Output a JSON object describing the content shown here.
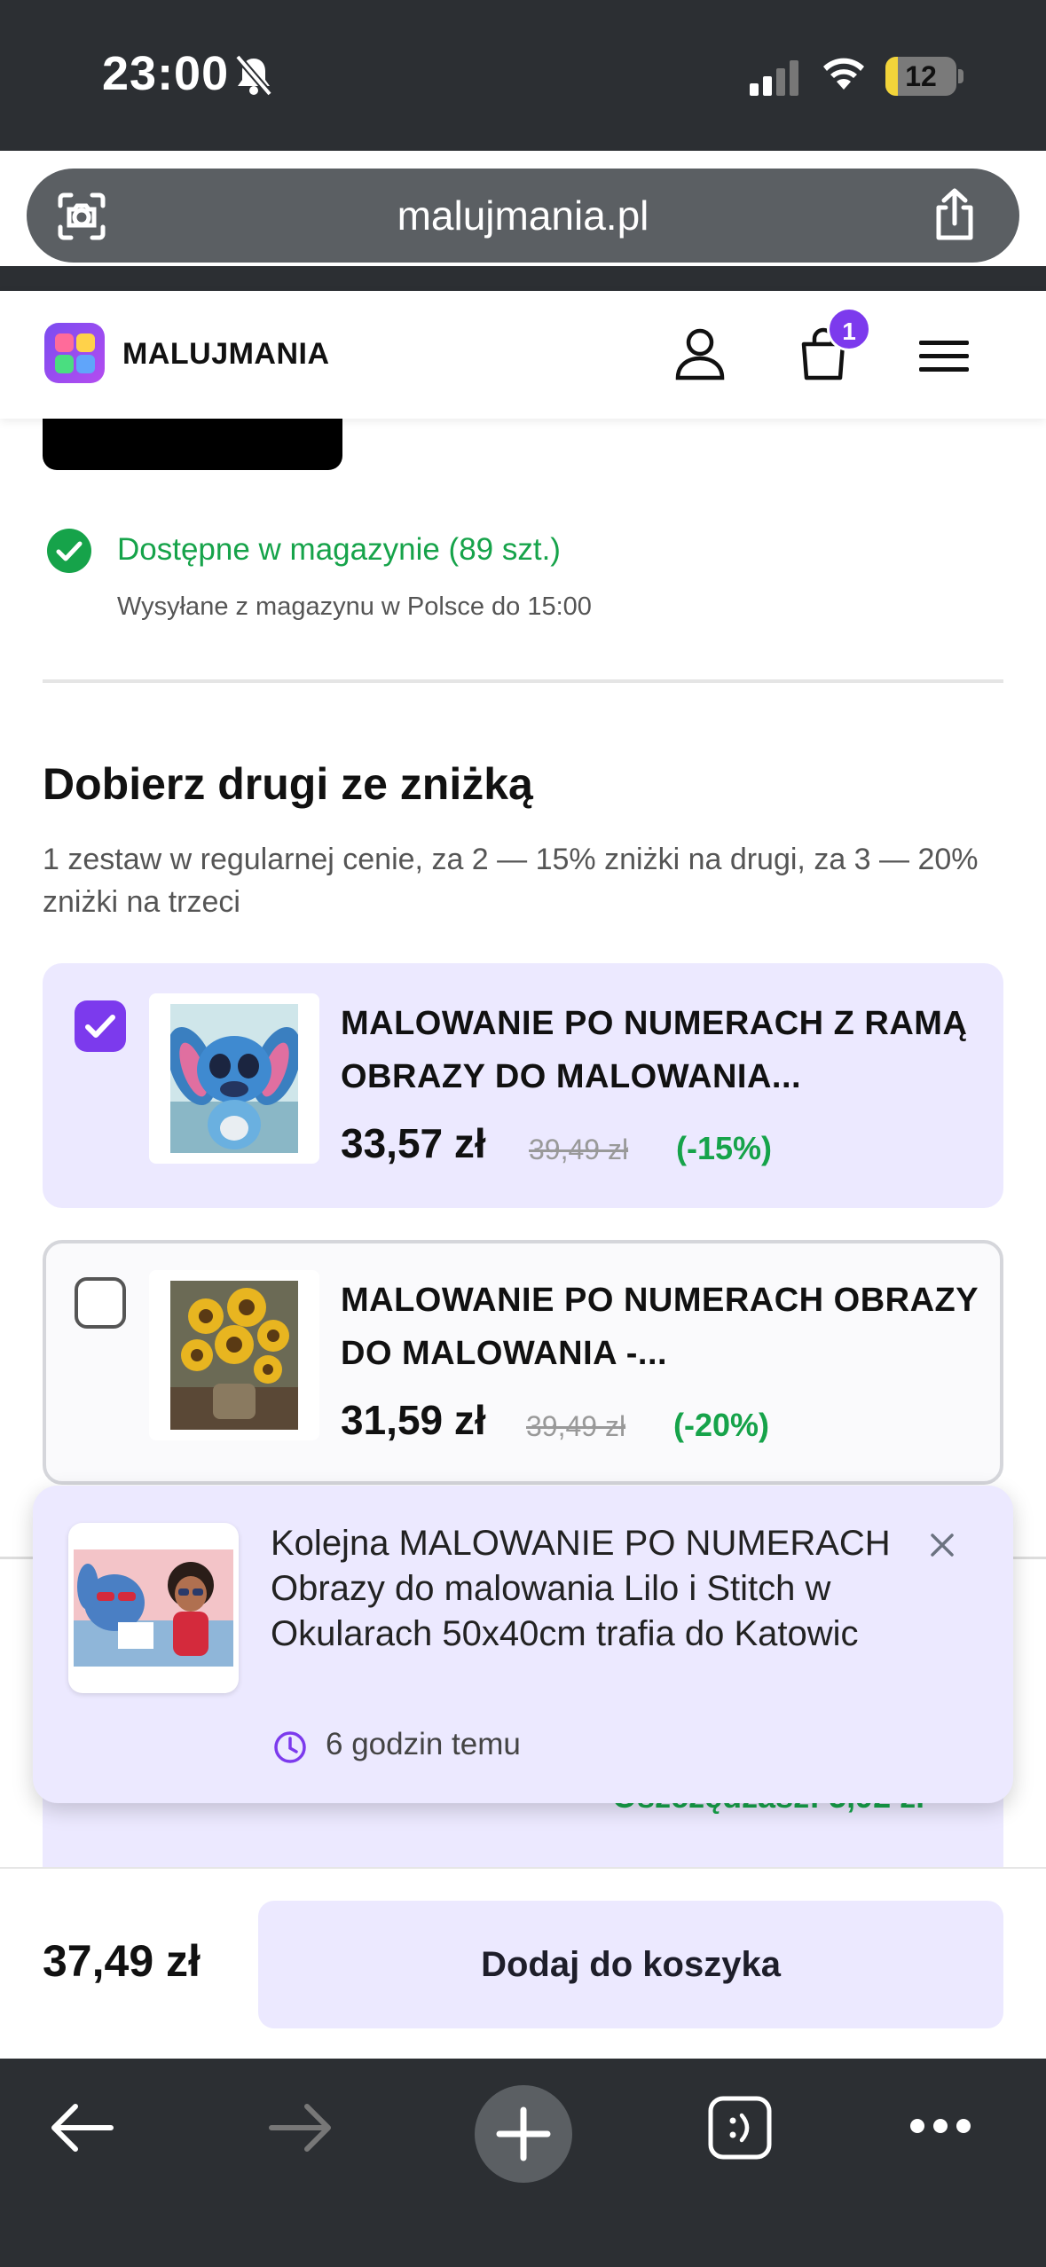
{
  "status_bar": {
    "time": "23:00",
    "battery": "12"
  },
  "browser": {
    "url": "malujmania.pl"
  },
  "site_header": {
    "brand": "MALUJMANIA",
    "cart_count": "1"
  },
  "stock": {
    "status": "Dostępne w magazynie (89 szt.)",
    "shipping": "Wysyłane z magazynu w Polsce do 15:00"
  },
  "bundle": {
    "title": "Dobierz drugi ze zniżką",
    "subtitle": "1 zestaw w regularnej cenie, za 2 — 15% zniżki na drugi, za 3 — 20% zniżki na trzeci",
    "items": [
      {
        "title": "MALOWANIE PO NUMERACH Z RAMĄ OBRAZY DO MALOWANIA...",
        "price": "33,57 zł",
        "old_price": "39,49 zł",
        "discount": "(-15%)",
        "checked": true
      },
      {
        "title": "MALOWANIE PO NUMERACH OBRAZY DO MALOWANIA -...",
        "price": "31,59 zł",
        "old_price": "39,49 zł",
        "discount": "(-20%)",
        "checked": false
      }
    ]
  },
  "savings_partial": "Oszczędzasz: 5,92 zł",
  "toast": {
    "message": "Kolejna MALOWANIE PO NUMERACH Obrazy do malowania Lilo i Stitch w Okularach 50x40cm trafia do Katowic",
    "time": "6 godzin temu"
  },
  "footer": {
    "total": "37,49 zł",
    "add_to_cart": "Dodaj do koszyka"
  },
  "colors": {
    "accent": "#7c3aed",
    "success": "#16a34a",
    "card_bg": "#ece9ff",
    "chrome": "#2c2f33"
  }
}
